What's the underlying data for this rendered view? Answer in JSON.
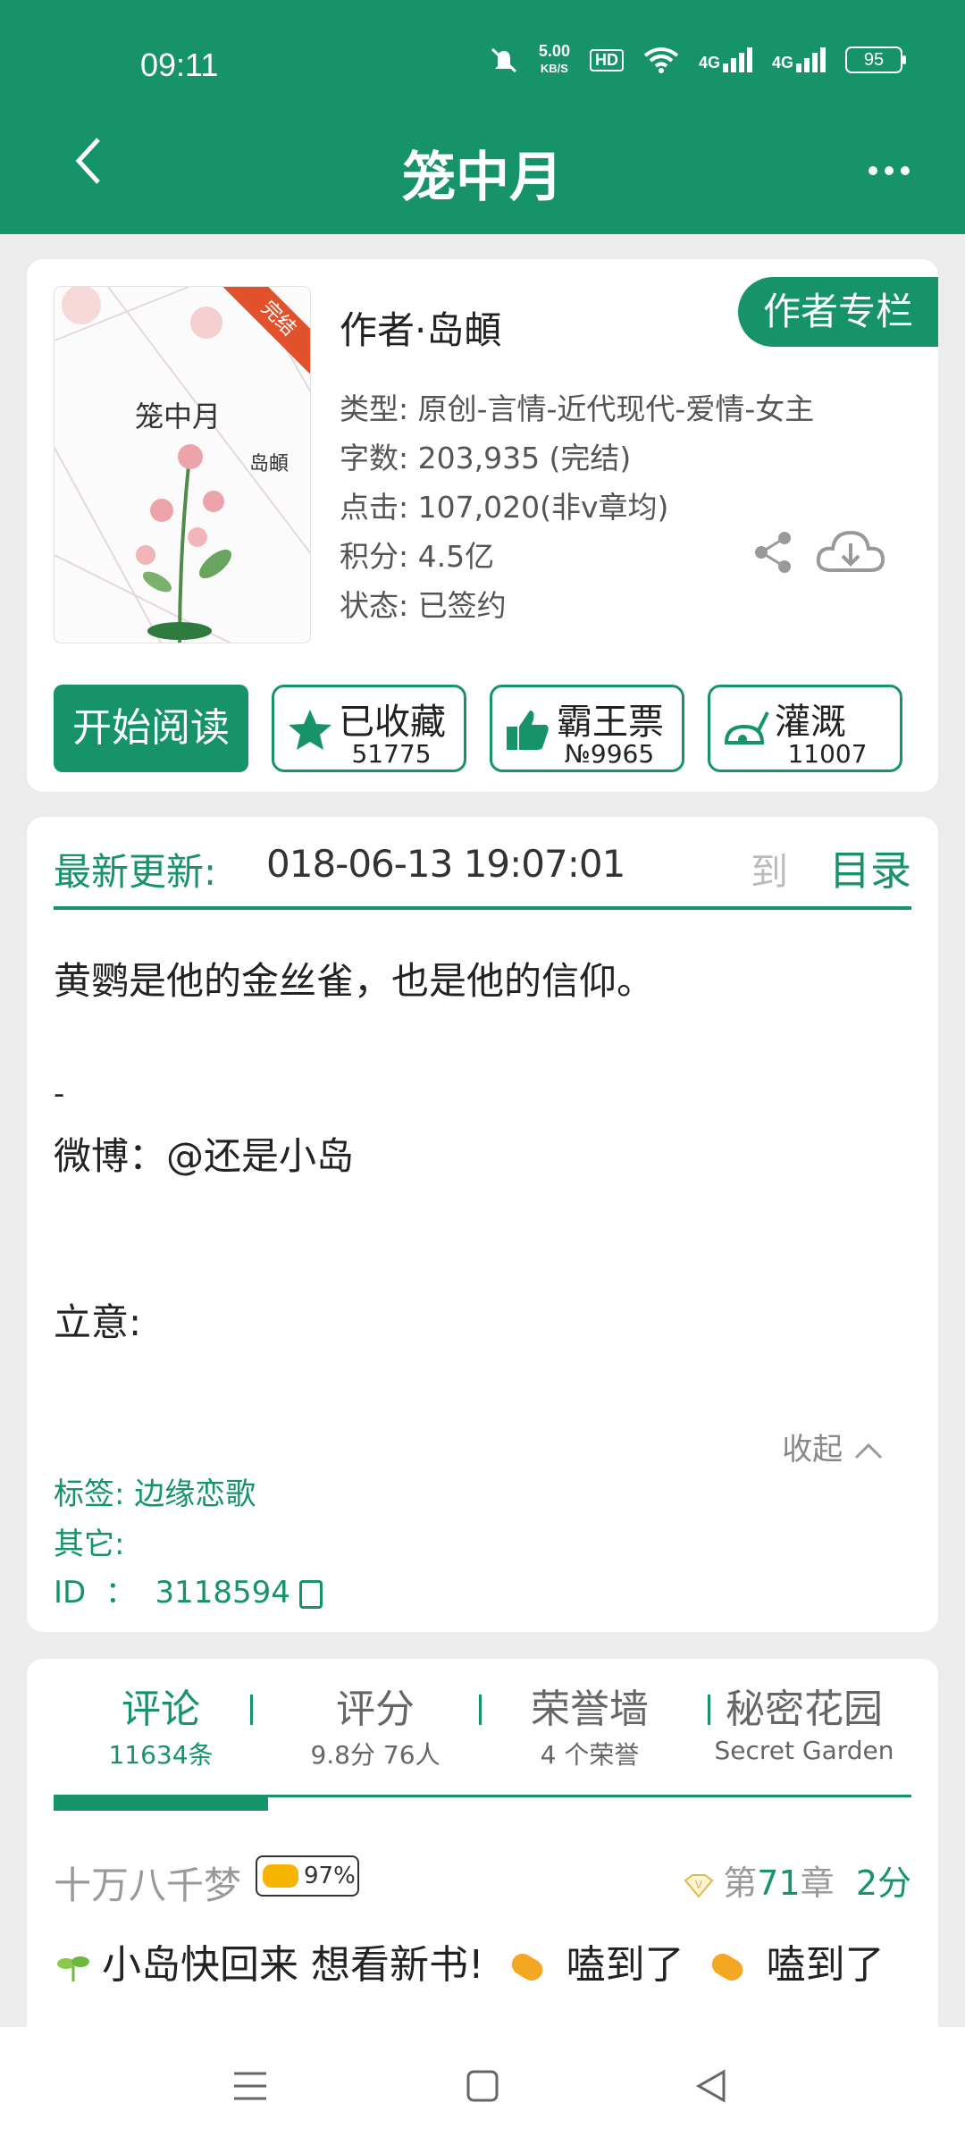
{
  "status_bar": {
    "time": "09:11",
    "net_speed_value": "5.00",
    "net_speed_unit": "KB/S",
    "hd": "HD",
    "signal1": "4G",
    "signal2": "4G",
    "battery": "95"
  },
  "header": {
    "title": "笼中月"
  },
  "book": {
    "cover_title": "笼中月",
    "cover_author": "岛頔",
    "ribbon": "完结",
    "author": "作者·岛頔",
    "author_column": "作者专栏",
    "type": "类型: 原创-言情-近代现代-爱情-女主",
    "words": "字数: 203,935 (完结)",
    "clicks": "点击: 107,020(非v章均)",
    "score": "积分: 4.5亿",
    "status": "状态: 已签约"
  },
  "actions": {
    "read": "开始阅读",
    "collect_label": "已收藏",
    "collect_count": "51775",
    "ticket_label": "霸王票",
    "ticket_count": "№9965",
    "water_label": "灌溉",
    "water_count": "11007"
  },
  "update": {
    "label": "最新更新:",
    "date": "018-06-13 19:07:01",
    "fragment": "到",
    "toc": "目录"
  },
  "description": {
    "line1": "黄鹦是他的金丝雀，也是他的信仰。",
    "line2": "-",
    "line3": "微博：@还是小岛",
    "line4": "立意:",
    "collapse": "收起"
  },
  "meta": {
    "tags_label": "标签:",
    "tags_value": "边缘恋歌",
    "other": "其它:",
    "id_label": "ID  ：",
    "id_value": "3118594"
  },
  "tabs": [
    {
      "title": "评论",
      "sub": "11634条"
    },
    {
      "title": "评分",
      "sub": "9.8分 76人"
    },
    {
      "title": "荣誉墙",
      "sub": "4 个荣誉"
    },
    {
      "title": "秘密花园",
      "sub": "Secret Garden"
    }
  ],
  "comment": {
    "user": "十万八千梦",
    "badge": "97%",
    "chapter_pre": "第",
    "chapter_num": "71",
    "chapter_post": "章",
    "score": "2分",
    "text1": "小岛快回来 想看新书!",
    "text2": "嗑到了",
    "text3": "嗑到了"
  },
  "colors": {
    "primary": "#17936a",
    "ribbon": "#e2512b"
  }
}
